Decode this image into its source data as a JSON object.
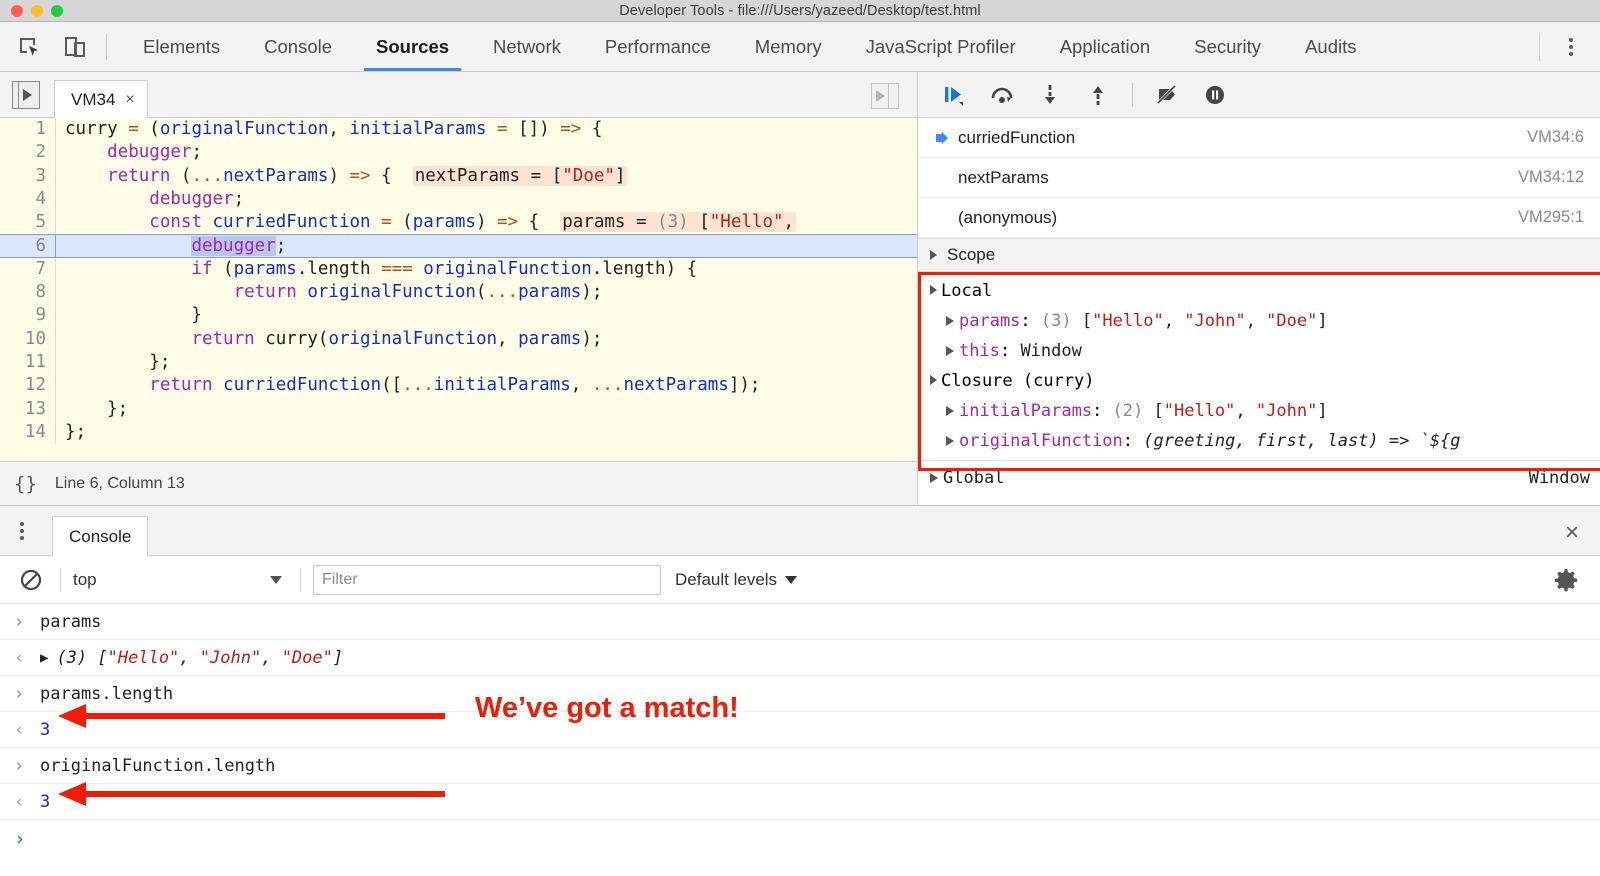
{
  "window": {
    "title": "Developer Tools - file:///Users/yazeed/Desktop/test.html",
    "traffic_lights": [
      "close-red",
      "minimize-yellow",
      "zoom-green"
    ]
  },
  "devtools_tabs": {
    "items": [
      {
        "label": "Elements",
        "active": false
      },
      {
        "label": "Console",
        "active": false
      },
      {
        "label": "Sources",
        "active": true
      },
      {
        "label": "Network",
        "active": false
      },
      {
        "label": "Performance",
        "active": false
      },
      {
        "label": "Memory",
        "active": false
      },
      {
        "label": "JavaScript Profiler",
        "active": false
      },
      {
        "label": "Application",
        "active": false
      },
      {
        "label": "Security",
        "active": false
      },
      {
        "label": "Audits",
        "active": false
      }
    ],
    "left_icons": [
      "inspect-element-icon",
      "device-toolbar-icon"
    ],
    "right_icon": "more-options-kebab-icon",
    "active_underline_color": "#4285f4"
  },
  "editor": {
    "navigator_toggle_icon": "show-navigator-icon",
    "debugger_toggle_icon": "show-debugger-sidebar-icon",
    "file_tab": {
      "label": "VM34",
      "close": "×"
    },
    "status": {
      "icon": "pretty-print-braces-icon",
      "text": "Line 6, Column 13"
    },
    "execution_line": 6,
    "lines": [
      {
        "n": "1",
        "tokens": [
          {
            "t": "curry ",
            "c": "pl"
          },
          {
            "t": "= ",
            "c": "op"
          },
          {
            "t": "(",
            "c": "pl"
          },
          {
            "t": "originalFunction",
            "c": "v"
          },
          {
            "t": ", ",
            "c": "pl"
          },
          {
            "t": "initialParams ",
            "c": "v"
          },
          {
            "t": "= ",
            "c": "op"
          },
          {
            "t": "[]) ",
            "c": "pl"
          },
          {
            "t": "=> ",
            "c": "op"
          },
          {
            "t": "{",
            "c": "pl"
          }
        ]
      },
      {
        "n": "2",
        "tokens": [
          {
            "t": "    ",
            "c": "pl"
          },
          {
            "t": "debugger",
            "c": "k"
          },
          {
            "t": ";",
            "c": "pl"
          }
        ]
      },
      {
        "n": "3",
        "tokens": [
          {
            "t": "    ",
            "c": "pl"
          },
          {
            "t": "return ",
            "c": "k"
          },
          {
            "t": "(",
            "c": "pl"
          },
          {
            "t": "...",
            "c": "op"
          },
          {
            "t": "nextParams",
            "c": "v"
          },
          {
            "t": ") ",
            "c": "pl"
          },
          {
            "t": "=> ",
            "c": "op"
          },
          {
            "t": "{  ",
            "c": "pl"
          }
        ],
        "inline": [
          {
            "t": "nextParams = ",
            "c": "pl"
          },
          {
            "t": "[",
            "c": "pl"
          },
          {
            "t": "\"Doe\"",
            "c": "s"
          },
          {
            "t": "]",
            "c": "pl"
          }
        ]
      },
      {
        "n": "4",
        "tokens": [
          {
            "t": "        ",
            "c": "pl"
          },
          {
            "t": "debugger",
            "c": "k"
          },
          {
            "t": ";",
            "c": "pl"
          }
        ]
      },
      {
        "n": "5",
        "tokens": [
          {
            "t": "        ",
            "c": "pl"
          },
          {
            "t": "const ",
            "c": "k"
          },
          {
            "t": "curriedFunction ",
            "c": "v"
          },
          {
            "t": "= ",
            "c": "op"
          },
          {
            "t": "(",
            "c": "pl"
          },
          {
            "t": "params",
            "c": "v"
          },
          {
            "t": ") ",
            "c": "pl"
          },
          {
            "t": "=> ",
            "c": "op"
          },
          {
            "t": "{  ",
            "c": "pl"
          }
        ],
        "inline": [
          {
            "t": "params = ",
            "c": "pl"
          },
          {
            "t": "(3) ",
            "c": "num-dim"
          },
          {
            "t": "[",
            "c": "pl"
          },
          {
            "t": "\"Hello\"",
            "c": "s"
          },
          {
            "t": ",",
            "c": "pl"
          }
        ]
      },
      {
        "n": "6",
        "exec": true,
        "tokens": [
          {
            "t": "            ",
            "c": "pl"
          },
          {
            "t": "debugger",
            "c": "k sel"
          },
          {
            "t": ";",
            "c": "pl"
          }
        ]
      },
      {
        "n": "7",
        "tokens": [
          {
            "t": "            ",
            "c": "pl"
          },
          {
            "t": "if ",
            "c": "k"
          },
          {
            "t": "(",
            "c": "pl"
          },
          {
            "t": "params",
            "c": "v"
          },
          {
            "t": ".length ",
            "c": "pl"
          },
          {
            "t": "=== ",
            "c": "op"
          },
          {
            "t": "originalFunction",
            "c": "v"
          },
          {
            "t": ".length) {",
            "c": "pl"
          }
        ]
      },
      {
        "n": "8",
        "tokens": [
          {
            "t": "                ",
            "c": "pl"
          },
          {
            "t": "return ",
            "c": "k"
          },
          {
            "t": "originalFunction",
            "c": "v"
          },
          {
            "t": "(",
            "c": "pl"
          },
          {
            "t": "...",
            "c": "op"
          },
          {
            "t": "params",
            "c": "v"
          },
          {
            "t": ");",
            "c": "pl"
          }
        ]
      },
      {
        "n": "9",
        "tokens": [
          {
            "t": "            }",
            "c": "pl"
          }
        ]
      },
      {
        "n": "10",
        "tokens": [
          {
            "t": "            ",
            "c": "pl"
          },
          {
            "t": "return ",
            "c": "k"
          },
          {
            "t": "curry",
            "c": "pl"
          },
          {
            "t": "(",
            "c": "pl"
          },
          {
            "t": "originalFunction",
            "c": "v"
          },
          {
            "t": ", ",
            "c": "pl"
          },
          {
            "t": "params",
            "c": "v"
          },
          {
            "t": ");",
            "c": "pl"
          }
        ]
      },
      {
        "n": "11",
        "tokens": [
          {
            "t": "        };",
            "c": "pl"
          }
        ]
      },
      {
        "n": "12",
        "tokens": [
          {
            "t": "        ",
            "c": "pl"
          },
          {
            "t": "return ",
            "c": "k"
          },
          {
            "t": "curriedFunction",
            "c": "v"
          },
          {
            "t": "([",
            "c": "pl"
          },
          {
            "t": "...",
            "c": "op"
          },
          {
            "t": "initialParams",
            "c": "v"
          },
          {
            "t": ", ",
            "c": "pl"
          },
          {
            "t": "...",
            "c": "op"
          },
          {
            "t": "nextParams",
            "c": "v"
          },
          {
            "t": "]);",
            "c": "pl"
          }
        ]
      },
      {
        "n": "13",
        "tokens": [
          {
            "t": "    };",
            "c": "pl"
          }
        ]
      },
      {
        "n": "14",
        "tokens": [
          {
            "t": "};",
            "c": "pl"
          }
        ]
      }
    ]
  },
  "debugger": {
    "toolbar_icons": [
      "resume-script-icon",
      "step-over-icon",
      "step-into-icon",
      "step-out-icon",
      "deactivate-breakpoints-icon",
      "pause-on-exceptions-icon"
    ],
    "call_stack": [
      {
        "name": "curriedFunction",
        "location": "VM34:6",
        "current": true
      },
      {
        "name": "nextParams",
        "location": "VM34:12",
        "current": false
      },
      {
        "name": "(anonymous)",
        "location": "VM295:1",
        "current": false
      }
    ],
    "scope_header": "Scope",
    "scope": [
      {
        "indent": 0,
        "toggle": "down",
        "label": "Local"
      },
      {
        "indent": 1,
        "toggle": "right",
        "prop": "params",
        "sep": ": ",
        "dim": "(3) ",
        "value_parts": [
          {
            "t": "[",
            "c": "pl"
          },
          {
            "t": "\"Hello\"",
            "c": "str"
          },
          {
            "t": ", ",
            "c": "pl"
          },
          {
            "t": "\"John\"",
            "c": "str"
          },
          {
            "t": ", ",
            "c": "pl"
          },
          {
            "t": "\"Doe\"",
            "c": "str"
          },
          {
            "t": "]",
            "c": "pl"
          }
        ]
      },
      {
        "indent": 1,
        "toggle": "right",
        "prop": "this",
        "sep": ": ",
        "dim": "",
        "value_parts": [
          {
            "t": "Window",
            "c": "pl"
          }
        ]
      },
      {
        "indent": 0,
        "toggle": "down",
        "label": "Closure (curry)"
      },
      {
        "indent": 1,
        "toggle": "right",
        "prop": "initialParams",
        "sep": ": ",
        "dim": "(2) ",
        "value_parts": [
          {
            "t": "[",
            "c": "pl"
          },
          {
            "t": "\"Hello\"",
            "c": "str"
          },
          {
            "t": ", ",
            "c": "pl"
          },
          {
            "t": "\"John\"",
            "c": "str"
          },
          {
            "t": "]",
            "c": "pl"
          }
        ]
      },
      {
        "indent": 1,
        "toggle": "right",
        "prop": "originalFunction",
        "sep": ": ",
        "dim": "",
        "value_parts": [
          {
            "t": "(greeting, first, last) => `${g",
            "c": "fn"
          }
        ]
      }
    ],
    "global": {
      "label": "Global",
      "value": "Window"
    },
    "highlight_box_color": "#f01c08"
  },
  "drawer": {
    "kebab_icon": "drawer-more-options-icon",
    "tab_label": "Console",
    "close_icon": "×",
    "toolbar": {
      "clear_icon": "clear-console-icon",
      "context": "top",
      "filter_placeholder": "Filter",
      "filter_value": "",
      "levels": "Default levels",
      "settings_icon": "console-settings-gear-icon"
    },
    "rows": [
      {
        "kind": "input",
        "marker": "›",
        "text": "params"
      },
      {
        "kind": "output",
        "marker": "‹",
        "expander": "▶",
        "parts": [
          {
            "t": "(3) ",
            "c": "dim-italic"
          },
          {
            "t": "[",
            "c": "dim-italic"
          },
          {
            "t": "\"Hello\"",
            "c": "str-italic"
          },
          {
            "t": ", ",
            "c": "dim-italic"
          },
          {
            "t": "\"John\"",
            "c": "str-italic"
          },
          {
            "t": ", ",
            "c": "dim-italic"
          },
          {
            "t": "\"Doe\"",
            "c": "str-italic"
          },
          {
            "t": "]",
            "c": "dim-italic"
          }
        ]
      },
      {
        "kind": "input",
        "marker": "›",
        "text": "params.length"
      },
      {
        "kind": "output-num",
        "marker": "‹",
        "text": "3"
      },
      {
        "kind": "input",
        "marker": "›",
        "text": "originalFunction.length"
      },
      {
        "kind": "output-num",
        "marker": "‹",
        "text": "3"
      }
    ],
    "prompt_marker": "›"
  },
  "annotation": {
    "text": "We’ve got a match!",
    "color": "#f01c08",
    "arrows": 2
  }
}
